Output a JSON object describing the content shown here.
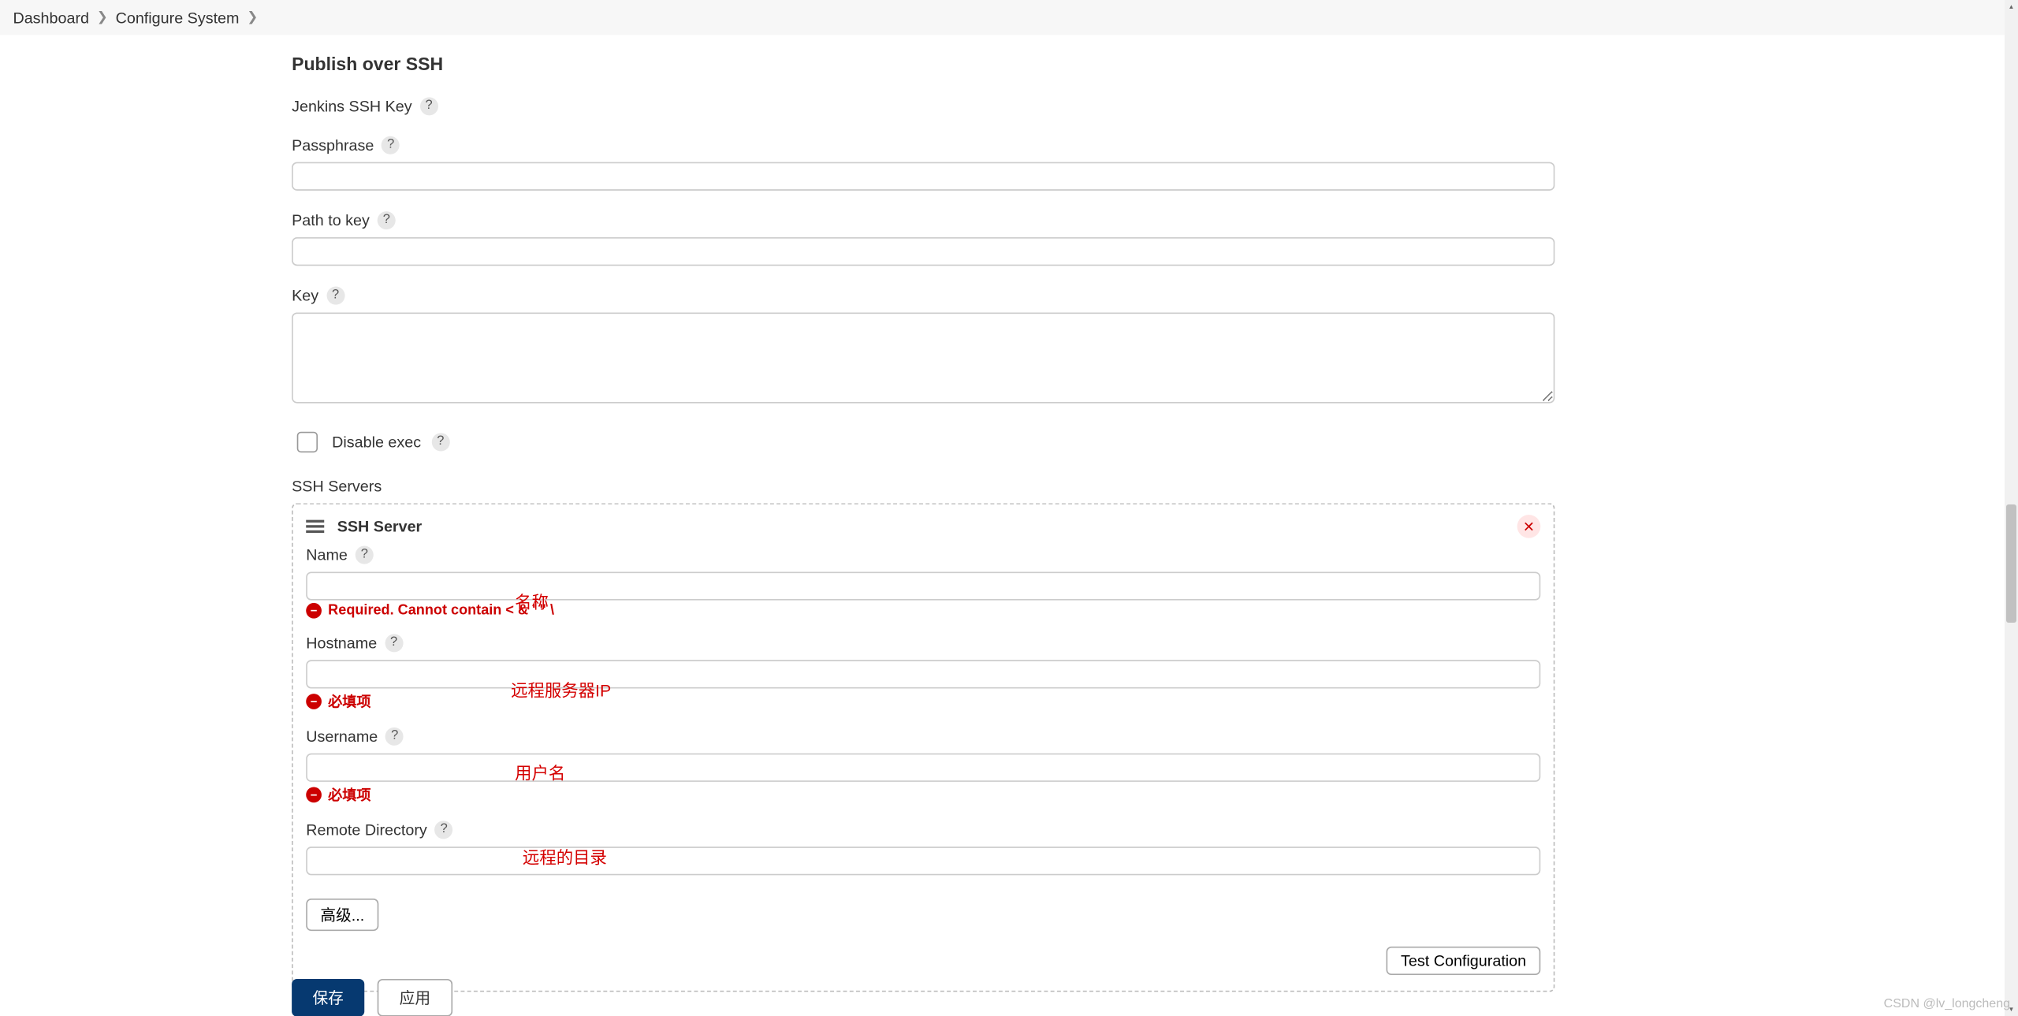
{
  "breadcrumb": {
    "items": [
      "Dashboard",
      "Configure System"
    ]
  },
  "section_title": "Publish over SSH",
  "jenkins_key": {
    "heading": "Jenkins SSH Key"
  },
  "passphrase": {
    "label": "Passphrase",
    "value": ""
  },
  "path_to_key": {
    "label": "Path to key",
    "value": ""
  },
  "key": {
    "label": "Key",
    "value": ""
  },
  "disable_exec": {
    "label": "Disable exec",
    "checked": false
  },
  "ssh_servers": {
    "heading": "SSH Servers",
    "server_title": "SSH Server",
    "name": {
      "label": "Name",
      "value": "",
      "error": "Required. Cannot contain < & ' \" \\",
      "annotation": "名称"
    },
    "hostname": {
      "label": "Hostname",
      "value": "",
      "error": "必填项",
      "annotation": "远程服务器IP"
    },
    "username": {
      "label": "Username",
      "value": "",
      "error": "必填项",
      "annotation": "用户名"
    },
    "remote_dir": {
      "label": "Remote Directory",
      "value": "",
      "annotation": "远程的目录"
    },
    "advanced_button": "高级...",
    "test_button": "Test Configuration"
  },
  "buttons": {
    "save": "保存",
    "apply": "应用"
  },
  "watermark": "CSDN @lv_longcheng"
}
